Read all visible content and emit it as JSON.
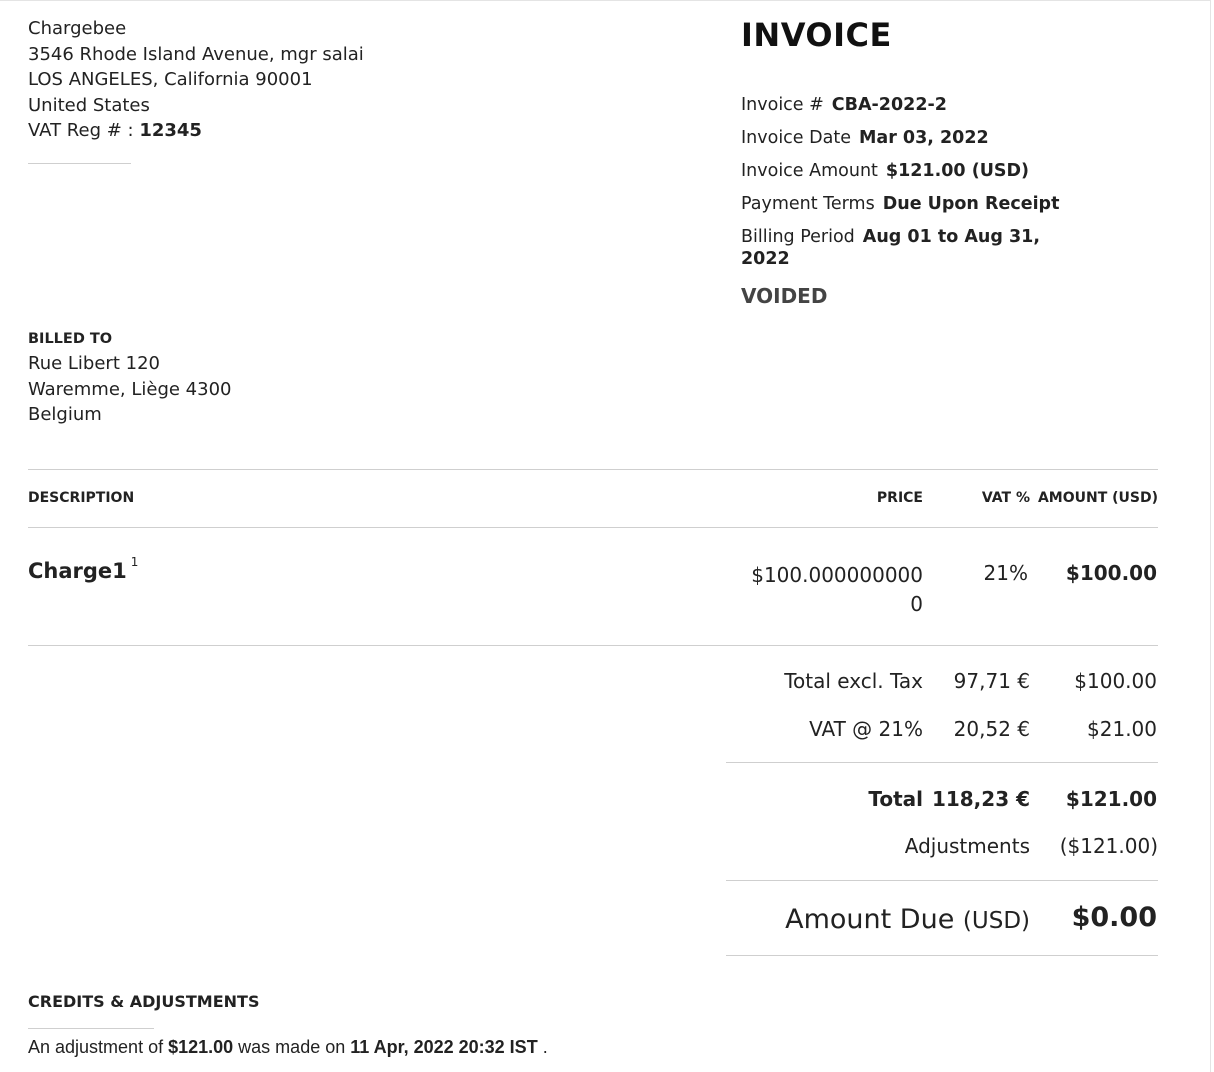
{
  "seller": {
    "name": "Chargebee",
    "address1": "3546 Rhode Island Avenue, mgr salai",
    "address2": "LOS ANGELES, California 90001",
    "country": "United States",
    "vat_label": "VAT Reg # : ",
    "vat_value": "12345"
  },
  "invoice": {
    "title": "INVOICE",
    "number_label": "Invoice #",
    "number": "CBA-2022-2",
    "date_label": "Invoice Date",
    "date": "Mar 03, 2022",
    "amount_label": "Invoice Amount",
    "amount": "$121.00 (USD)",
    "terms_label": "Payment Terms",
    "terms": "Due Upon Receipt",
    "period_label": "Billing Period",
    "period": "Aug 01 to Aug 31, 2022",
    "status": "VOIDED"
  },
  "billed_to": {
    "heading": "BILLED TO",
    "line1": "Rue Libert 120",
    "line2": "Waremme, Liège 4300",
    "line3": "Belgium"
  },
  "table": {
    "headers": {
      "description": "DESCRIPTION",
      "price": "PRICE",
      "vat": "VAT %",
      "amount": "AMOUNT (USD)"
    },
    "items": [
      {
        "description": "Charge1",
        "footnote": "1",
        "price": "$100.0000000000",
        "vat": "21%",
        "amount": "$100.00"
      }
    ]
  },
  "totals": {
    "excl_label": "Total excl. Tax",
    "excl_eur": "97,71 €",
    "excl_usd": "$100.00",
    "vat_label": "VAT @ 21%",
    "vat_eur": "20,52 €",
    "vat_usd": "$21.00",
    "total_label": "Total",
    "total_eur": "118,23 €",
    "total_usd": "$121.00",
    "adjust_label": "Adjustments",
    "adjust_usd": "($121.00)",
    "due_label": "Amount Due",
    "due_currency": "(USD)",
    "due_amount": "$0.00"
  },
  "credits": {
    "heading": "CREDITS & ADJUSTMENTS",
    "text_pre": "An adjustment of ",
    "amount": "$121.00",
    "text_mid": " was made on ",
    "date": "11 Apr, 2022 20:32 IST",
    "text_post": " ."
  }
}
